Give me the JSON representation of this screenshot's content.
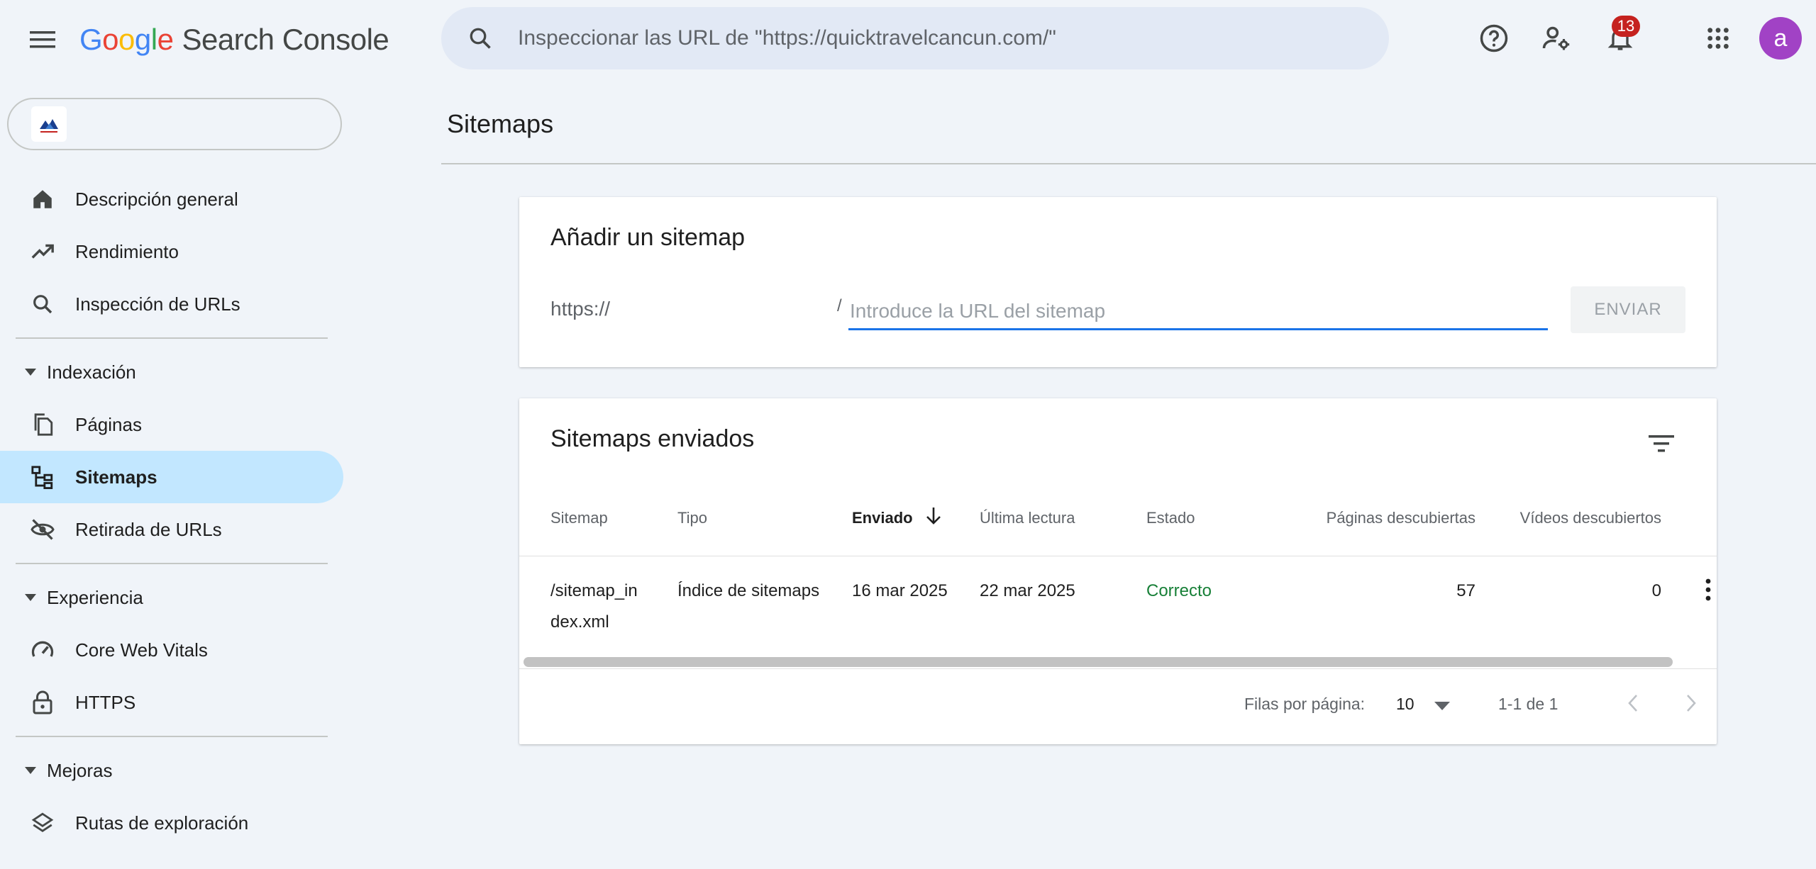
{
  "header": {
    "logo_letters": [
      "G",
      "o",
      "o",
      "g",
      "l",
      "e"
    ],
    "product": "Search Console",
    "search_placeholder": "Inspeccionar las URL de \"https://quicktravelcancun.com/\"",
    "notifications_count": "13",
    "avatar_letter": "a"
  },
  "sidebar": {
    "property_value": "",
    "items": [
      {
        "label": "Descripción general",
        "icon": "home-icon"
      },
      {
        "label": "Rendimiento",
        "icon": "trending-up-icon"
      },
      {
        "label": "Inspección de URLs",
        "icon": "search-icon"
      }
    ],
    "section_indexacion": "Indexación",
    "indexacion_items": [
      {
        "label": "Páginas",
        "icon": "pages-icon"
      },
      {
        "label": "Sitemaps",
        "icon": "sitemap-icon"
      },
      {
        "label": "Retirada de URLs",
        "icon": "visibility-off-icon"
      }
    ],
    "section_experiencia": "Experiencia",
    "experiencia_items": [
      {
        "label": "Core Web Vitals",
        "icon": "speed-icon"
      },
      {
        "label": "HTTPS",
        "icon": "lock-icon"
      }
    ],
    "section_mejoras": "Mejoras",
    "mejoras_items": [
      {
        "label": "Rutas de exploración",
        "icon": "layers-icon"
      }
    ]
  },
  "page": {
    "title": "Sitemaps"
  },
  "add_sitemap": {
    "title": "Añadir un sitemap",
    "prefix": "https://",
    "slash": "/",
    "placeholder": "Introduce la URL del sitemap",
    "submit_label": "ENVIAR"
  },
  "submitted": {
    "title": "Sitemaps enviados",
    "columns": [
      "Sitemap",
      "Tipo",
      "Enviado",
      "Última lectura",
      "Estado",
      "Páginas descubiertas",
      "Vídeos descubiertos"
    ],
    "rows": [
      {
        "sitemap_line1": "/sitemap_in",
        "sitemap_line2": "dex.xml",
        "type": "Índice de sitemaps",
        "submitted": "16 mar 2025",
        "last_read": "22 mar 2025",
        "status": "Correcto",
        "pages": "57",
        "videos": "0"
      }
    ],
    "rows_per_page_label": "Filas por página:",
    "rows_per_page_value": "10",
    "range": "1-1 de 1"
  },
  "colors": {
    "accent": "#1a73e8",
    "active_nav": "#c2e7ff",
    "status_ok": "#188038",
    "badge": "#c5221f",
    "avatar": "#a142c5"
  }
}
